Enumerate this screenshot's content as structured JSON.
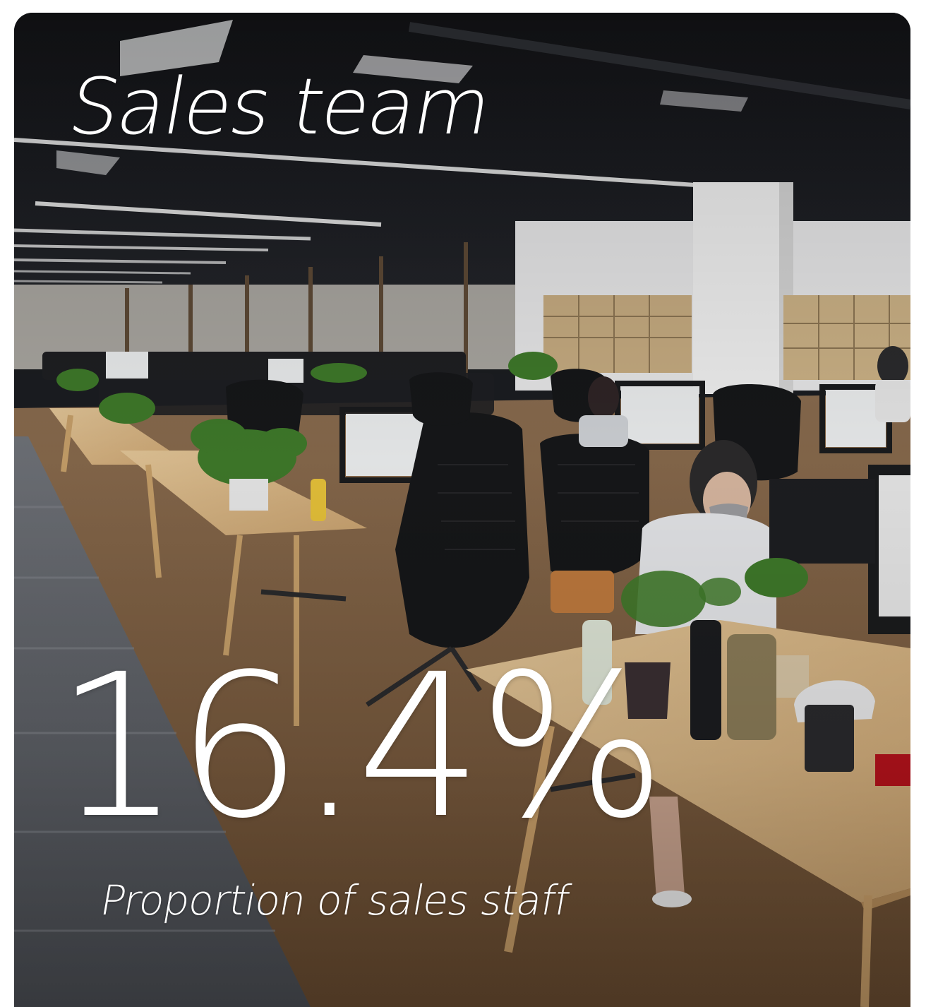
{
  "card": {
    "title": "Sales team",
    "metric_value": "16.4%",
    "caption": "Proportion of sales staff"
  },
  "colors": {
    "text": "#ffffff",
    "ceiling": "#17181b",
    "floor_wood": "#8d6a45",
    "desk_wood": "#d8b886",
    "plant_green": "#3f7a2a"
  },
  "icons": [
    "office-photo"
  ]
}
